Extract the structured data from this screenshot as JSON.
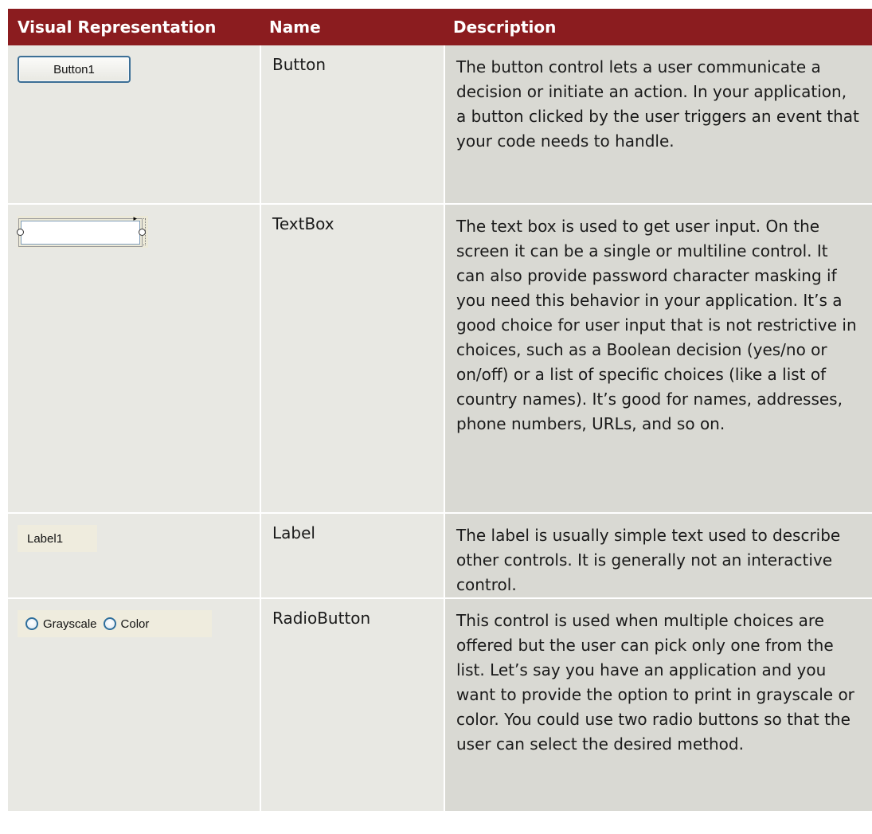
{
  "header": {
    "col1": "Visual Representation",
    "col2": "Name",
    "col3": "Description"
  },
  "rows": [
    {
      "name": "Button",
      "control_text": "Button1",
      "description": "The button control lets a user communicate a decision or initiate an action. In your application, a button clicked by the user triggers an event that your code needs to handle."
    },
    {
      "name": "TextBox",
      "description": "The text box is used to get user input. On the screen it can be a single or multiline control. It can also provide password character masking if you need this behavior in your application. It’s a good choice for user input that is not restrictive in choices, such as a Boolean decision (yes/no or on/off) or a list of specific choices (like a list of country names). It’s good for names, addresses, phone numbers, URLs, and so on."
    },
    {
      "name": "Label",
      "control_text": "Label1",
      "description": "The label is usually simple text used to describe other controls. It is generally not an interactive control."
    },
    {
      "name": "RadioButton",
      "option1": "Grayscale",
      "option2": "Color",
      "description": "This control is used when multiple choices are offered but the user can pick only one from the list. Let’s say you have an application and you want to provide the option to print in grayscale or color. You could use two radio buttons so that the user can select the desired method."
    }
  ]
}
